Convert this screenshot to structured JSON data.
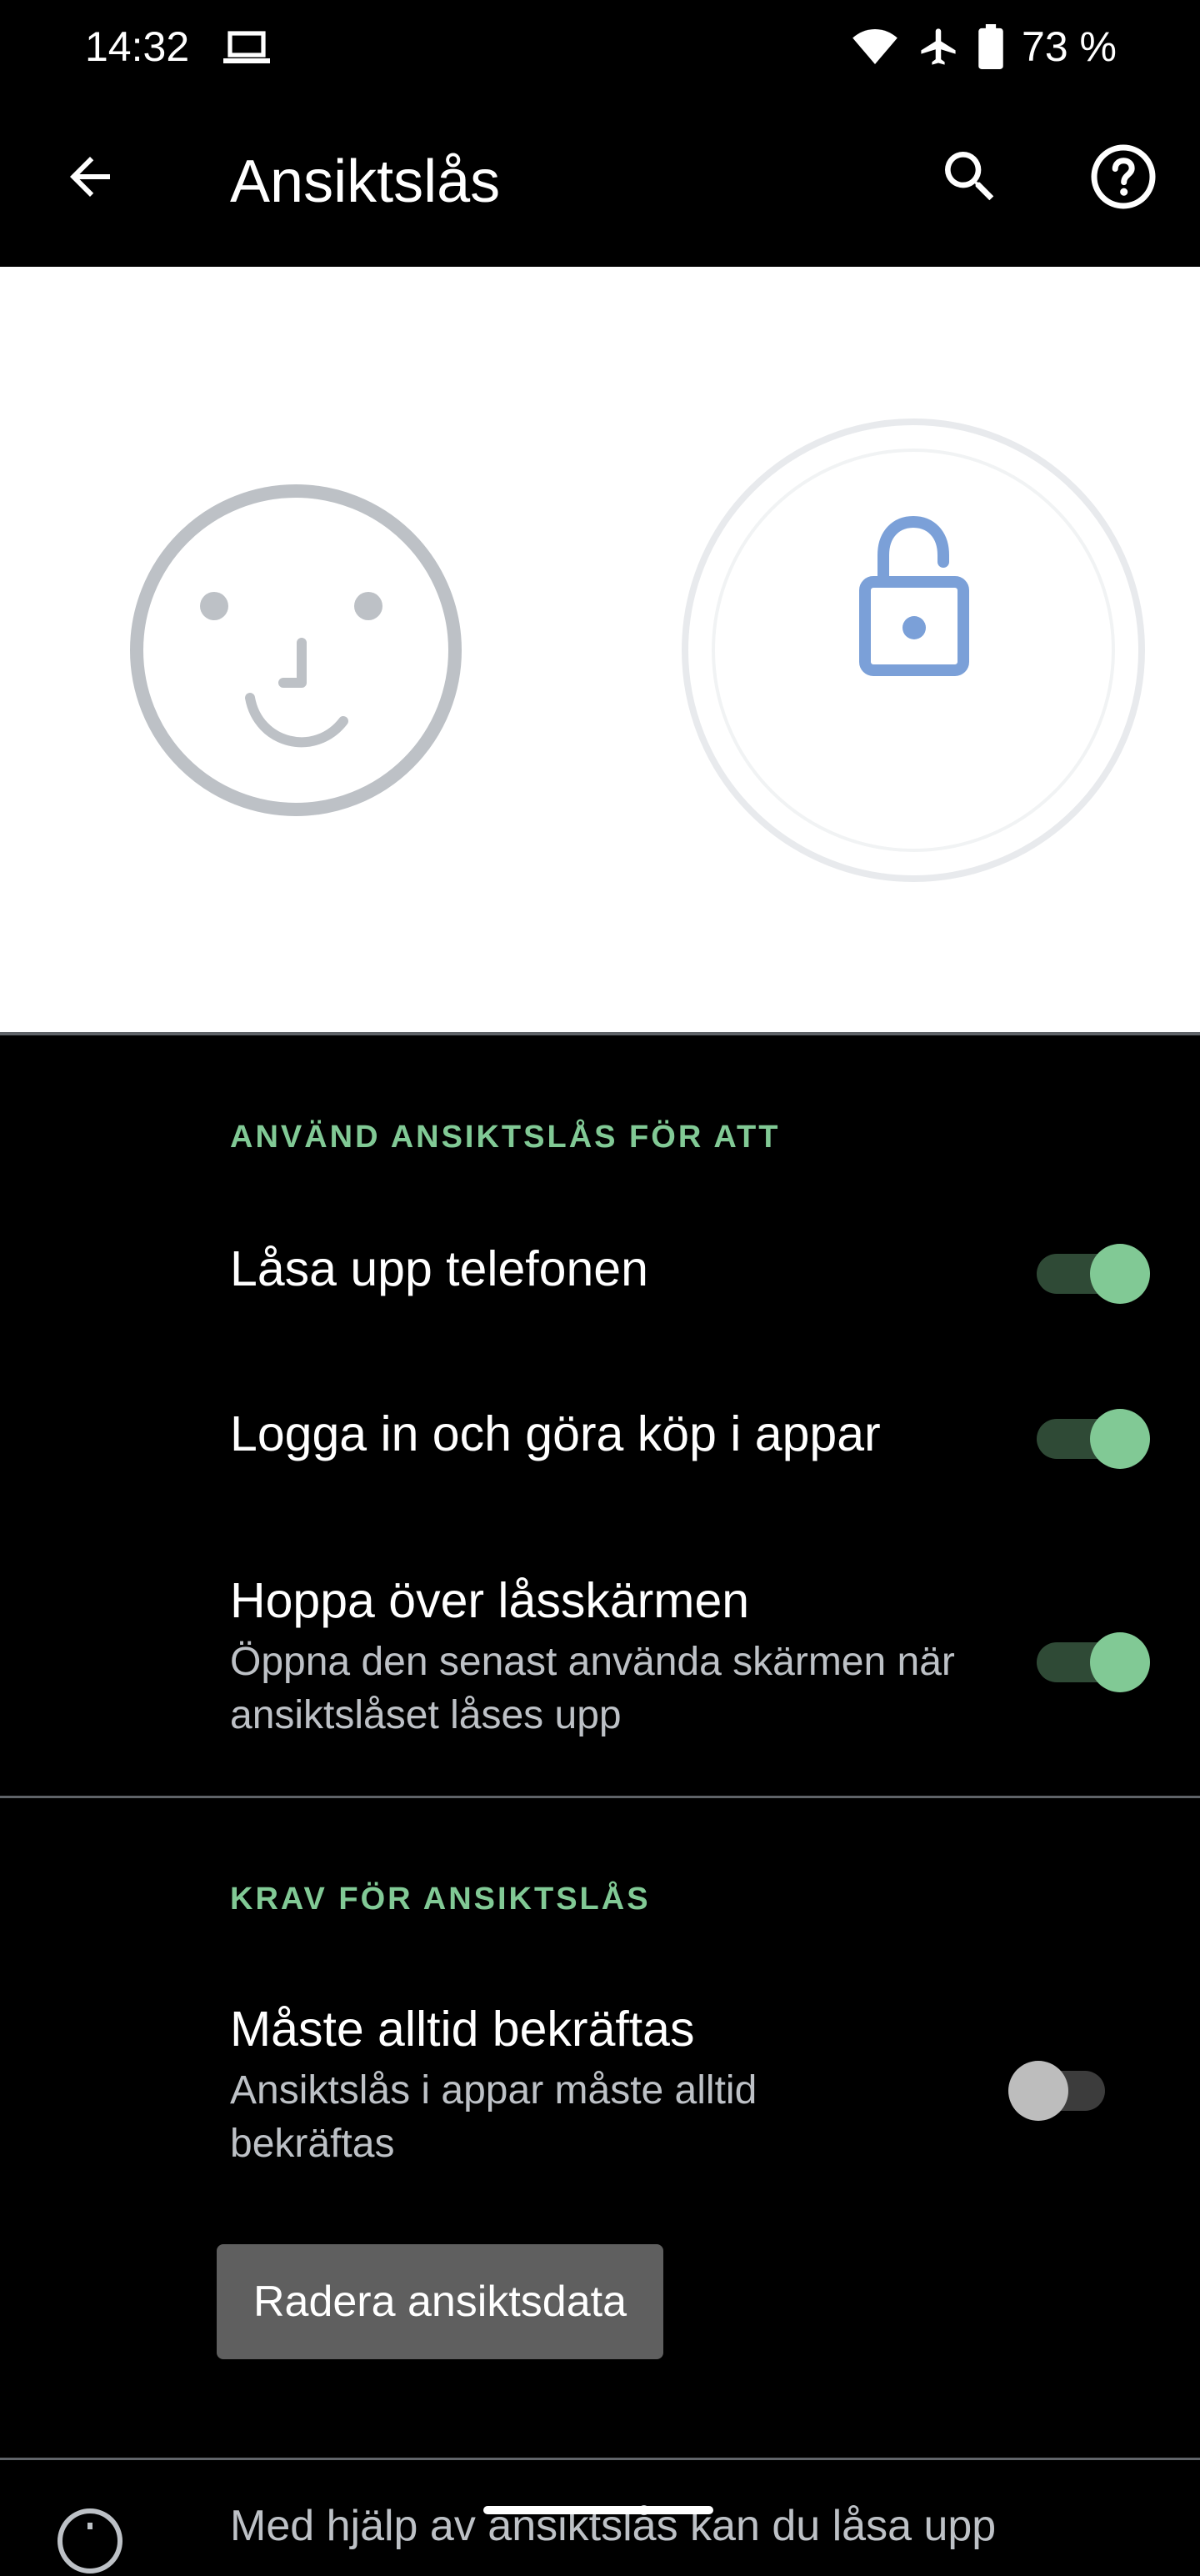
{
  "status_bar": {
    "time": "14:32",
    "battery_text": "73 %",
    "icons": [
      "laptop-icon",
      "wifi-icon",
      "airplane-icon",
      "battery-icon"
    ]
  },
  "app_bar": {
    "title": "Ansiktslås",
    "icons": [
      "back-arrow-icon",
      "search-icon",
      "help-icon"
    ]
  },
  "hero": {
    "icons": [
      "face-outline-icon",
      "lock-open-icon"
    ],
    "colors": {
      "face": "#bdc1c6",
      "lock": "#7ba0d8",
      "ring": "#e8eaed"
    }
  },
  "sections": {
    "use_for": {
      "header": "ANVÄND ANSIKTSLÅS FÖR ATT",
      "items": [
        {
          "title": "Låsa upp telefonen",
          "enabled": true
        },
        {
          "title": "Logga in och göra köp i appar",
          "enabled": true
        },
        {
          "title": "Hoppa över låsskärmen",
          "summary": "Öppna den senast använda skärmen när ansiktslåset låses upp",
          "enabled": true
        }
      ]
    },
    "requirements": {
      "header": "KRAV FÖR ANSIKTSLÅS",
      "items": [
        {
          "title": "Måste alltid bekräftas",
          "summary": "Ansiktslås i appar måste alltid bekräftas",
          "enabled": false
        }
      ]
    }
  },
  "delete_button": {
    "label": "Radera ansiktsdata"
  },
  "footer": {
    "text": "Med hjälp av ansiktslås kan du låsa upp",
    "icon": "info-icon"
  },
  "colors": {
    "accent": "#81c995",
    "background": "#000000",
    "secondary_text": "#bdc1c6"
  }
}
